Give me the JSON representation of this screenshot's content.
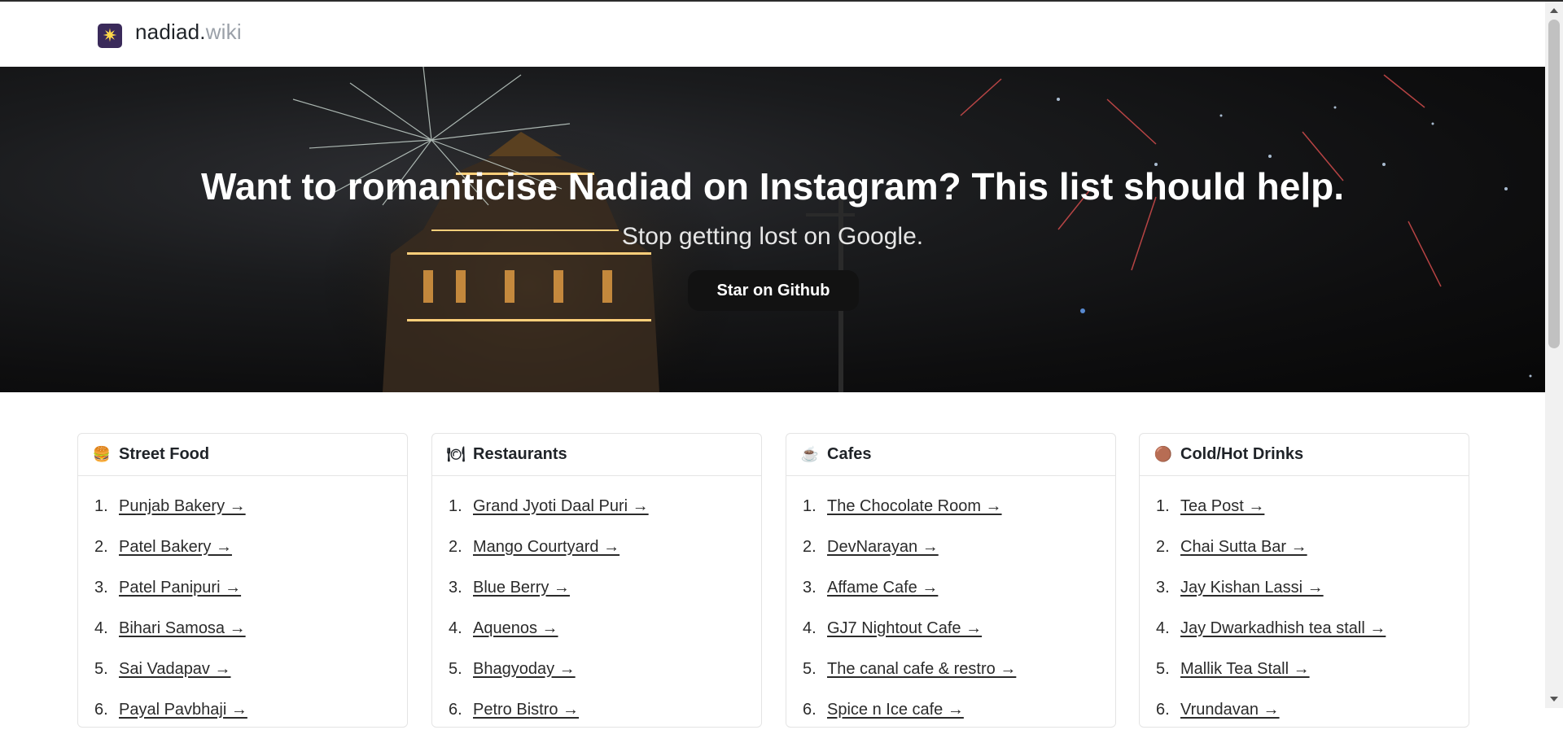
{
  "header": {
    "logo_icon": "sparkler-icon",
    "brand_main": "nadiad.",
    "brand_suffix": "wiki"
  },
  "hero": {
    "title": "Want to romanticise Nadiad on Instagram? This list should help.",
    "subtitle": "Stop getting lost on Google.",
    "button_label": "Star on Github"
  },
  "categories": [
    {
      "icon": "burger-icon",
      "title": "Street Food",
      "items": [
        "Punjab Bakery →",
        "Patel Bakery →",
        "Patel Panipuri →",
        "Bihari Samosa →",
        "Sai Vadapav →",
        "Payal Pavbhaji →"
      ]
    },
    {
      "icon": "plate-icon",
      "title": "Restaurants",
      "items": [
        "Grand Jyoti Daal Puri →",
        "Mango Courtyard →",
        "Blue Berry →",
        "Aquenos →",
        "Bhagyoday →",
        "Petro Bistro →"
      ]
    },
    {
      "icon": "coffee-icon",
      "title": "Cafes",
      "items": [
        "The Chocolate Room →",
        "DevNarayan →",
        "Affame Cafe →",
        "GJ7 Nightout Cafe →",
        "The canal cafe & restro →",
        "Spice n Ice cafe →"
      ]
    },
    {
      "icon": "tea-icon",
      "title": "Cold/Hot Drinks",
      "items": [
        "Tea Post →",
        "Chai Sutta Bar →",
        "Jay Kishan Lassi →",
        "Jay Dwarkadhish tea stall →",
        "Mallik Tea Stall →",
        "Vrundavan →"
      ]
    }
  ]
}
